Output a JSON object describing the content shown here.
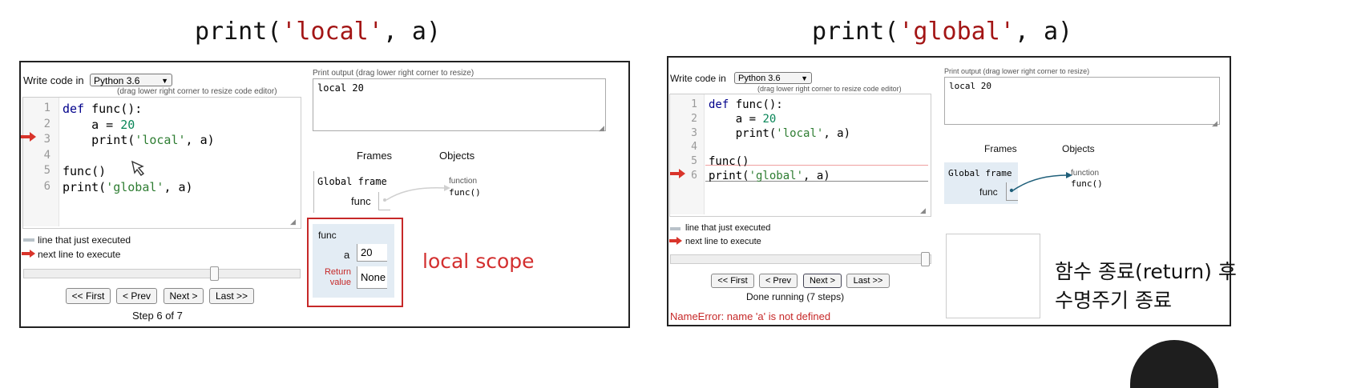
{
  "left": {
    "heading": {
      "pre": "print(",
      "str": "'local'",
      "post": ", a)"
    },
    "write_code_label": "Write code in",
    "language": "Python 3.6",
    "drag_hint": "(drag lower right corner to resize code editor)",
    "code_lines": [
      {
        "n": "1",
        "kw": "def",
        "text": " func():"
      },
      {
        "n": "2",
        "pre": "    a = ",
        "num": "20"
      },
      {
        "n": "3",
        "pre": "    print(",
        "str": "'local'",
        "post": ", a)"
      },
      {
        "n": "4",
        "text": ""
      },
      {
        "n": "5",
        "text": "func()"
      },
      {
        "n": "6",
        "pre": "print(",
        "str": "'global'",
        "post": ", a)"
      }
    ],
    "print_output_label": "Print output (drag lower right corner to resize)",
    "print_output": "local 20",
    "frames_header": "Frames",
    "objects_header": "Objects",
    "global_frame": "Global frame",
    "func_var": "func",
    "func_obj_type": "function",
    "func_obj_name": "func()",
    "local_frame_title": "func",
    "local_var_a": "a",
    "local_val_a": "20",
    "return_label_1": "Return",
    "return_label_2": "value",
    "return_val": "None",
    "legend_executed": "line that just executed",
    "legend_next": "next line to execute",
    "buttons": {
      "first": "<< First",
      "prev": "< Prev",
      "next": "Next >",
      "last": "Last >>"
    },
    "step_text": "Step 6 of 7",
    "annotation": "local scope",
    "slider_fraction": 0.85
  },
  "right": {
    "heading": {
      "pre": "print(",
      "str": "'global'",
      "post": ", a)"
    },
    "write_code_label": "Write code in",
    "language": "Python 3.6",
    "drag_hint": "(drag lower right corner to resize code editor)",
    "code_lines": [
      {
        "n": "1",
        "kw": "def",
        "text": " func():"
      },
      {
        "n": "2",
        "pre": "    a = ",
        "num": "20"
      },
      {
        "n": "3",
        "pre": "    print(",
        "str": "'local'",
        "post": ", a)"
      },
      {
        "n": "4",
        "text": ""
      },
      {
        "n": "5",
        "text": "func()"
      },
      {
        "n": "6",
        "pre": "print(",
        "str": "'global'",
        "post": ", a)"
      }
    ],
    "print_output_label": "Print output (drag lower right corner to resize)",
    "print_output": "local 20",
    "frames_header": "Frames",
    "objects_header": "Objects",
    "global_frame": "Global frame",
    "func_var": "func",
    "func_obj_type": "function",
    "func_obj_name": "func()",
    "legend_executed": "line that just executed",
    "legend_next": "next line to execute",
    "buttons": {
      "first": "<< First",
      "prev": "< Prev",
      "next": "Next >",
      "last": "Last >>"
    },
    "status_text": "Done running (7 steps)",
    "error_text": "NameError: name 'a' is not defined",
    "annotation_1": "함수 종료(return) 후",
    "annotation_2": "수명주기 종료",
    "slider_fraction": 1.0
  },
  "colors": {
    "accent_red": "#c62828",
    "string_red": "#a31515",
    "frame_blue": "#e3ecf4",
    "arrow_teal": "#1f5f7a"
  }
}
